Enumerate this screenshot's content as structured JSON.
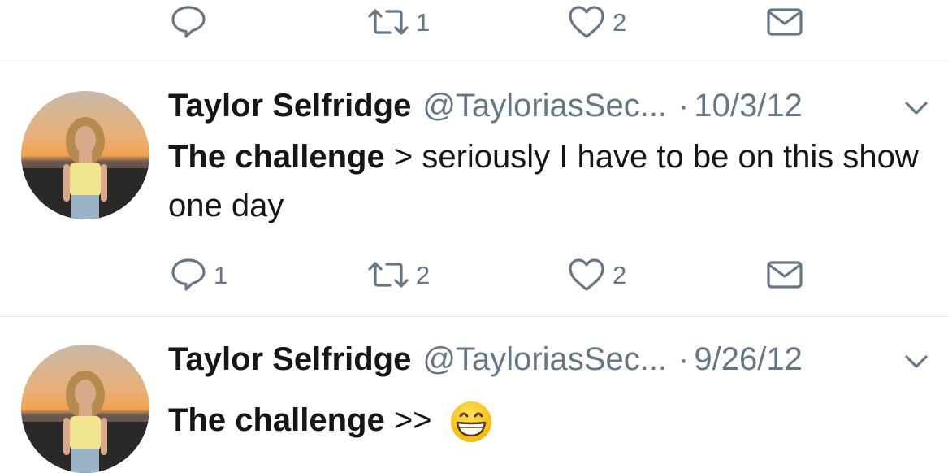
{
  "top_actions": {
    "reply_count": "",
    "retweet_count": "1",
    "like_count": "2"
  },
  "tweets": [
    {
      "name": "Taylor Selfridge",
      "handle": "@TayloriasSec...",
      "date": "10/3/12",
      "text_bold": "The challenge",
      "text_rest": " >  seriously I have to be on this show one day",
      "reply_count": "1",
      "retweet_count": "2",
      "like_count": "2"
    },
    {
      "name": "Taylor Selfridge",
      "handle": "@TayloriasSec...",
      "date": "9/26/12",
      "text_bold": "The challenge",
      "text_rest": " >> ",
      "emoji": "grinning-face"
    }
  ],
  "colors": {
    "text": "#14171a",
    "secondary": "#657786",
    "divider": "#e1e8ed"
  }
}
